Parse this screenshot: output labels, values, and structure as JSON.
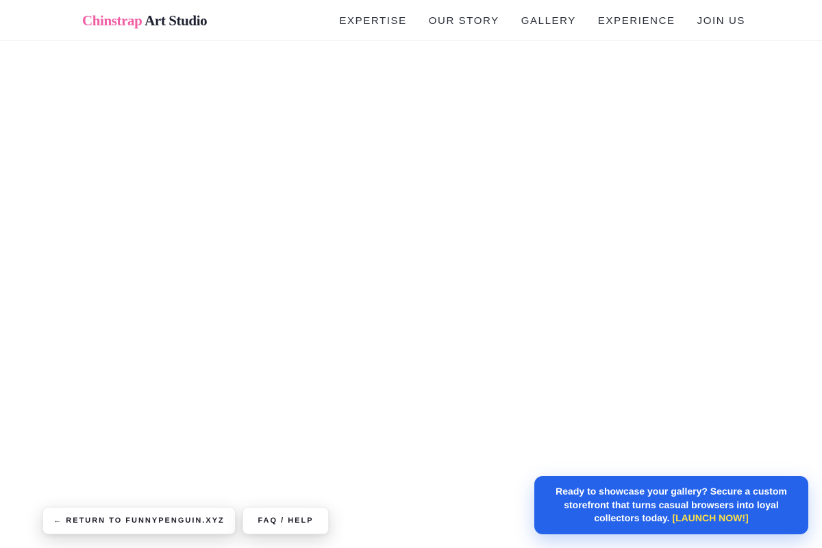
{
  "header": {
    "logo_accent": "Chinstrap",
    "logo_rest": " Art Studio",
    "nav": [
      "EXPERTISE",
      "OUR STORY",
      "GALLERY",
      "EXPERIENCE",
      "JOIN US"
    ]
  },
  "footer_buttons": {
    "return_label": "← RETURN TO FUNNYPENGUIN.XYZ",
    "faq_label": "FAQ / HELP"
  },
  "promo": {
    "message": "Ready to showcase your gallery? Secure a custom storefront that turns casual browsers into loyal collectors today. ",
    "cta": "[LAUNCH NOW!]"
  },
  "colors": {
    "logo_accent": "#f05fa4",
    "promo_background": "#2563eb",
    "promo_cta": "#fde047"
  }
}
